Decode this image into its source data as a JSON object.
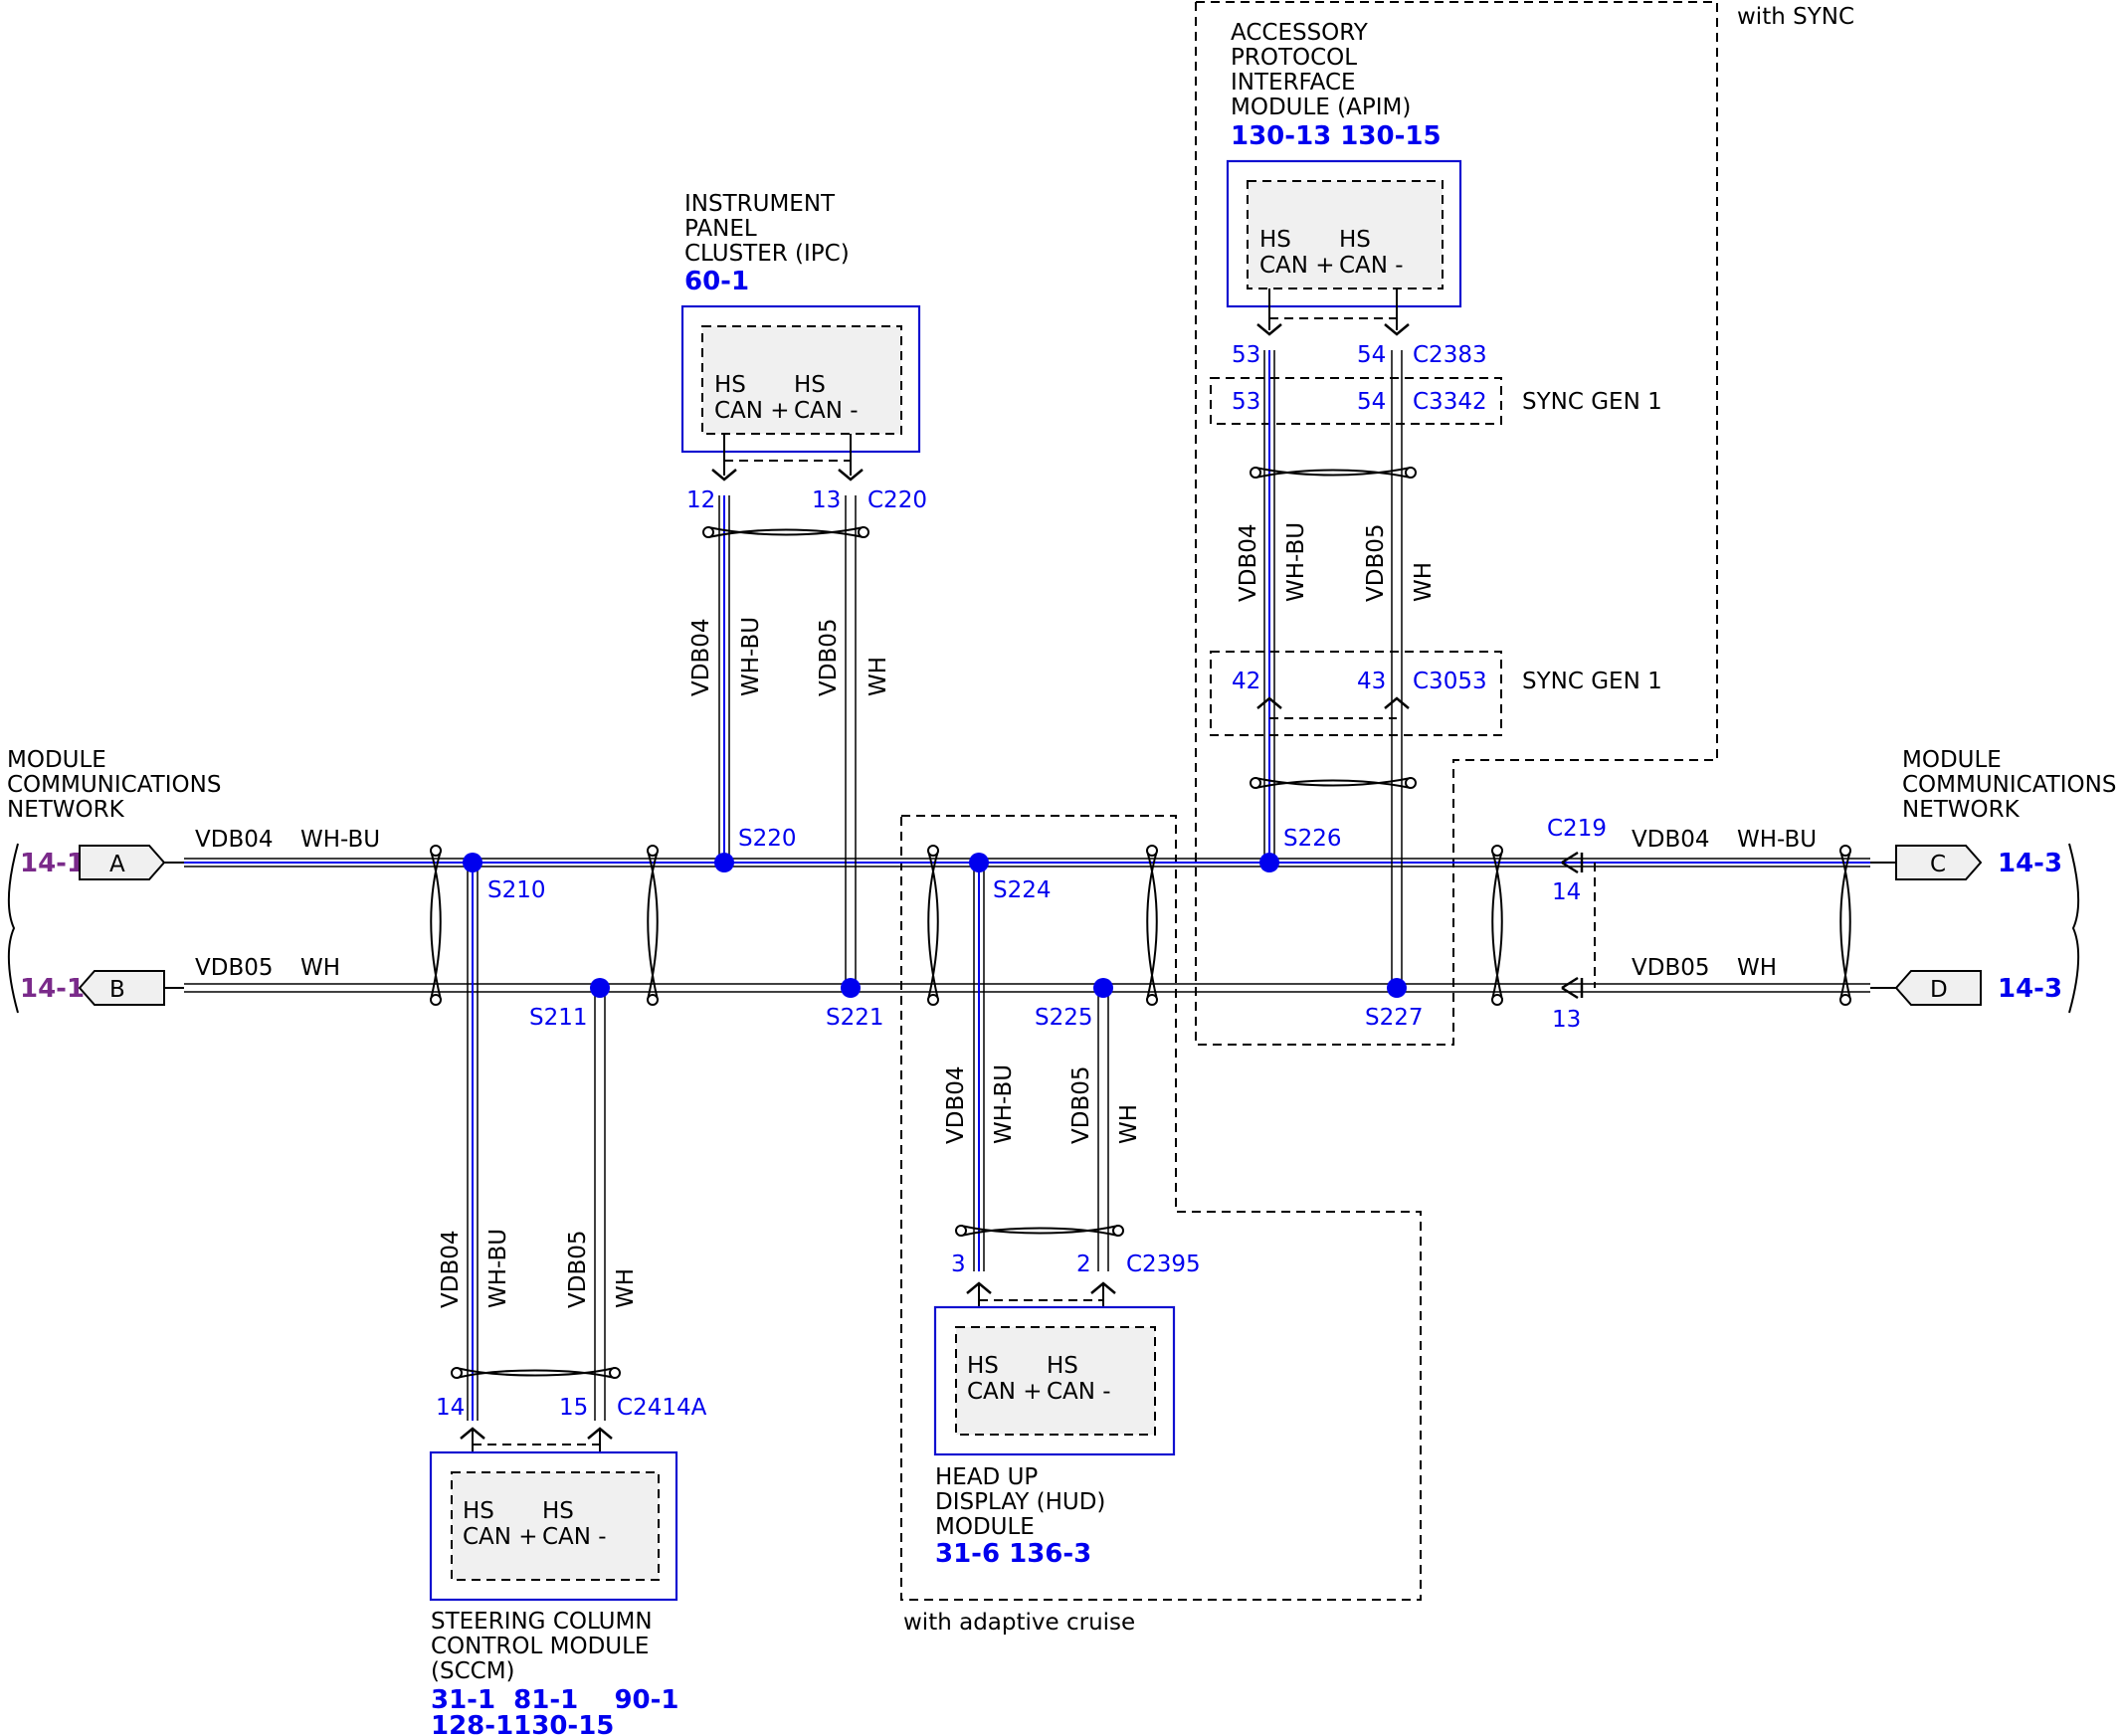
{
  "network_left": {
    "title_lines": [
      "MODULE",
      "COMMUNICATIONS",
      "NETWORK"
    ]
  },
  "network_right": {
    "title_lines": [
      "MODULE",
      "COMMUNICATIONS",
      "NETWORK"
    ]
  },
  "connectors": [
    {
      "letter": "A",
      "ref": "14-1"
    },
    {
      "letter": "B",
      "ref": "14-1"
    },
    {
      "letter": "C",
      "ref": "14-3"
    },
    {
      "letter": "D",
      "ref": "14-3"
    }
  ],
  "wires": {
    "vdb04": "VDB04",
    "wh_bu": "WH-BU",
    "vdb05": "VDB05",
    "wh": "WH"
  },
  "splices": [
    "S210",
    "S211",
    "S220",
    "S221",
    "S224",
    "S225",
    "S226",
    "S227"
  ],
  "ipc": {
    "name_lines": [
      "INSTRUMENT",
      "PANEL",
      "CLUSTER (IPC)"
    ],
    "refs": "60-1",
    "pins": {
      "hi": "12",
      "lo": "13"
    },
    "connector": "C220"
  },
  "apim": {
    "name_lines": [
      "ACCESSORY",
      "PROTOCOL",
      "INTERFACE",
      "MODULE (APIM)"
    ],
    "refs": "130-13 130-15",
    "pins_c2383": {
      "hi": "53",
      "lo": "54",
      "connector": "C2383"
    },
    "pins_c3342": {
      "hi": "53",
      "lo": "54",
      "connector": "C3342"
    },
    "pins_c3053": {
      "hi": "42",
      "lo": "43",
      "connector": "C3053"
    },
    "sync_gen_label": "SYNC GEN 1",
    "option_label": "with SYNC"
  },
  "hud": {
    "name_lines": [
      "HEAD UP",
      "DISPLAY (HUD)",
      "MODULE"
    ],
    "refs": "31-6   136-3",
    "pins": {
      "hi": "3",
      "lo": "2"
    },
    "connector": "C2395",
    "option_label": "with adaptive cruise"
  },
  "sccm": {
    "name_lines": [
      "STEERING COLUMN",
      "CONTROL MODULE",
      "(SCCM)"
    ],
    "refs_line1": "31-1  81-1    90-1",
    "refs_line2": "128-1130-15",
    "pins": {
      "hi": "14",
      "lo": "15"
    },
    "connector": "C2414A"
  },
  "c219": {
    "connector": "C219",
    "pin_hi": "14",
    "pin_lo": "13"
  },
  "module_pin_labels": {
    "hs": "HS",
    "can_plus": "CAN +",
    "can_minus": "CAN -"
  }
}
